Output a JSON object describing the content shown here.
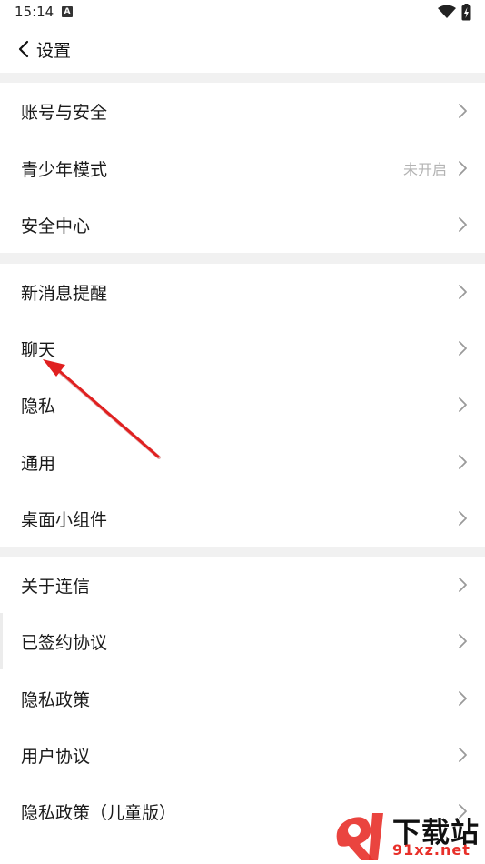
{
  "status_bar": {
    "time": "15:14",
    "indicator": "A"
  },
  "header": {
    "title": "设置",
    "back_icon": "chevron-left-icon"
  },
  "groups": [
    {
      "items": [
        {
          "label": "账号与安全",
          "value": ""
        },
        {
          "label": "青少年模式",
          "value": "未开启"
        },
        {
          "label": "安全中心",
          "value": ""
        }
      ]
    },
    {
      "items": [
        {
          "label": "新消息提醒",
          "value": ""
        },
        {
          "label": "聊天",
          "value": ""
        },
        {
          "label": "隐私",
          "value": ""
        },
        {
          "label": "通用",
          "value": ""
        },
        {
          "label": "桌面小组件",
          "value": ""
        }
      ]
    },
    {
      "items": [
        {
          "label": "关于连信",
          "value": ""
        },
        {
          "label": "已签约协议",
          "value": ""
        },
        {
          "label": "隐私政策",
          "value": ""
        },
        {
          "label": "用户协议",
          "value": ""
        },
        {
          "label": "隐私政策（儿童版）",
          "value": ""
        }
      ]
    }
  ],
  "watermark": {
    "brand": "下载站",
    "site": "91xz.net"
  },
  "colors": {
    "annotation_arrow": "#e02020",
    "group_gap": "#f1f1f1",
    "secondary_text": "#b3b3b3"
  }
}
